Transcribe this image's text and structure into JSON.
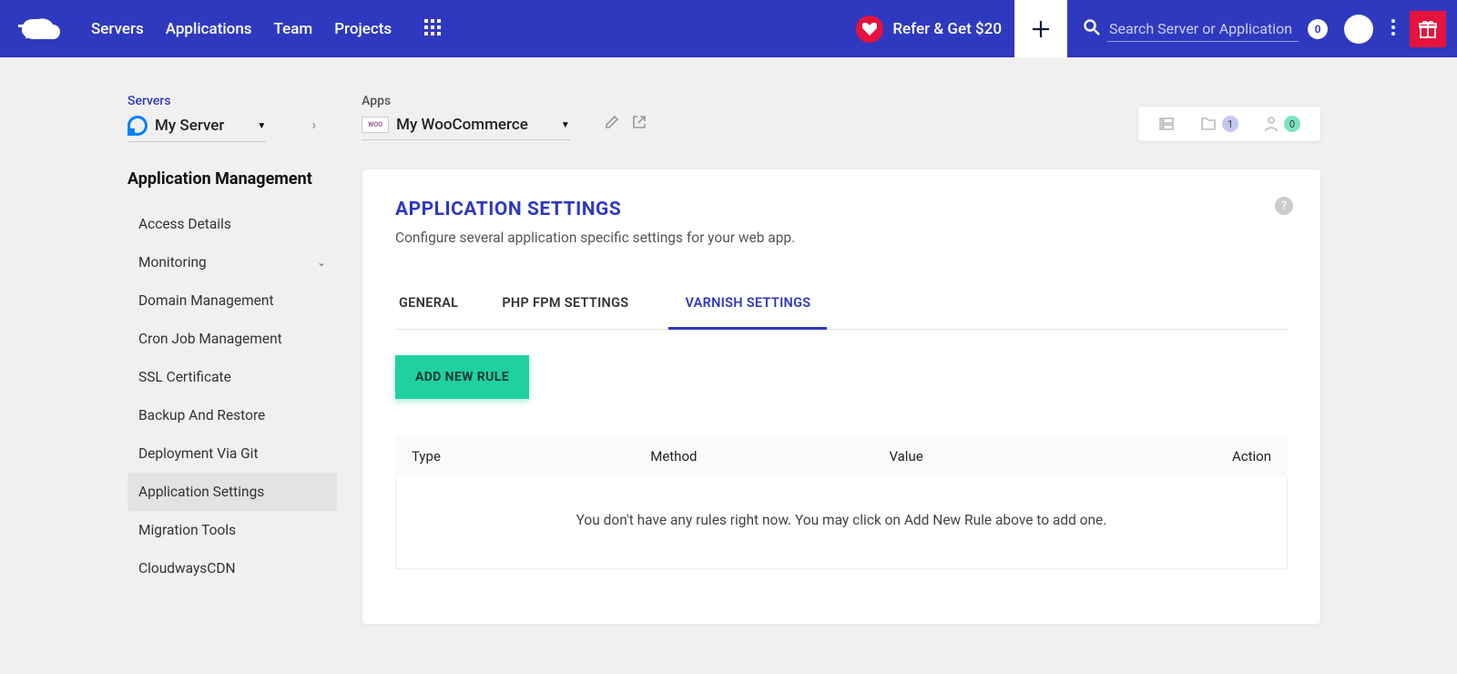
{
  "topnav": {
    "links": [
      "Servers",
      "Applications",
      "Team",
      "Projects"
    ],
    "refer": "Refer & Get $20",
    "search_placeholder": "Search Server or Application",
    "search_count": "0"
  },
  "breadcrumb": {
    "servers_label": "Servers",
    "server_name": "My Server",
    "apps_label": "Apps",
    "app_name": "My WooCommerce"
  },
  "stats": {
    "folder_count": "1",
    "user_count": "0"
  },
  "sidebar": {
    "title": "Application Management",
    "items": [
      {
        "label": "Access Details"
      },
      {
        "label": "Monitoring",
        "expandable": true
      },
      {
        "label": "Domain Management"
      },
      {
        "label": "Cron Job Management"
      },
      {
        "label": "SSL Certificate"
      },
      {
        "label": "Backup And Restore"
      },
      {
        "label": "Deployment Via Git"
      },
      {
        "label": "Application Settings",
        "active": true
      },
      {
        "label": "Migration Tools"
      },
      {
        "label": "CloudwaysCDN"
      }
    ]
  },
  "panel": {
    "title": "APPLICATION SETTINGS",
    "subtitle": "Configure several application specific settings for your web app.",
    "tabs": [
      {
        "label": "GENERAL"
      },
      {
        "label": "PHP FPM SETTINGS"
      },
      {
        "label": "VARNISH SETTINGS",
        "active": true
      }
    ],
    "add_button": "ADD NEW RULE",
    "columns": [
      "Type",
      "Method",
      "Value",
      "Action"
    ],
    "empty_message": "You don't have any rules right now. You may click on Add New Rule above to add one."
  }
}
